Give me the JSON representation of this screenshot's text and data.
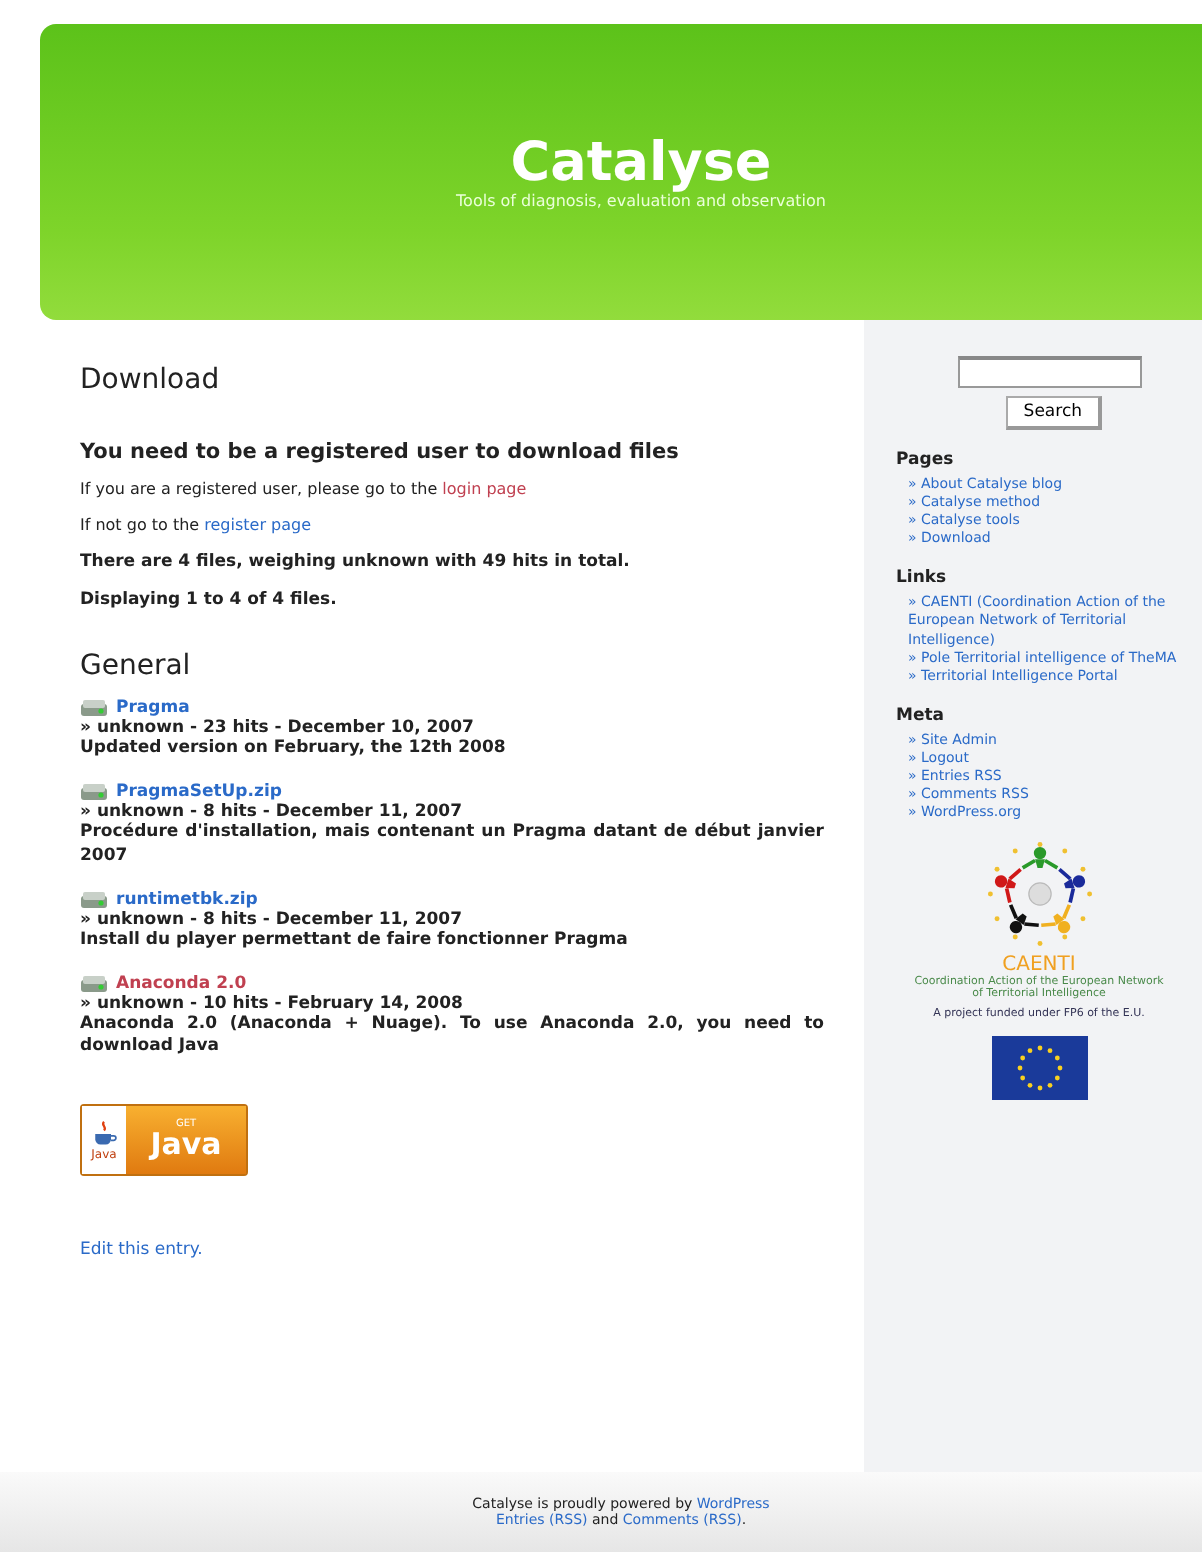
{
  "header": {
    "title": "Catalyse",
    "tagline": "Tools of diagnosis, evaluation and observation"
  },
  "main": {
    "heading": "Download",
    "notice": "You need to be a registered user to download files",
    "login_line": {
      "text": "If you are a registered user, please go to the",
      "link": "login page",
      "visited": true
    },
    "register_line": {
      "text": "If not go to the",
      "link": "register page",
      "visited": false
    },
    "summary": "There are 4 files, weighing unknown with 49 hits in total.",
    "displaying": "Displaying 1 to 4 of 4 files.",
    "section": "General",
    "files": [
      {
        "name": "Pragma",
        "visited": false,
        "meta": "» unknown - 23 hits - December 10, 2007",
        "description": "Updated version on February, the 12th 2008"
      },
      {
        "name": "PragmaSetUp.zip",
        "visited": false,
        "meta": "» unknown - 8 hits - December 11, 2007",
        "description": "Procédure d'installation, mais contenant un Pragma datant de début janvier 2007"
      },
      {
        "name": "runtimetbk.zip",
        "visited": false,
        "meta": "» unknown - 8 hits - December 11, 2007",
        "description": "Install du player permettant de faire fonctionner Pragma"
      },
      {
        "name": "Anaconda 2.0",
        "visited": true,
        "meta": "» unknown - 10 hits - February 14, 2008",
        "description": "Anaconda 2.0 (Anaconda + Nuage). To use Anaconda 2.0, you need to download Java"
      }
    ],
    "java_badge": {
      "small": "Java",
      "top": "GET",
      "big": "Java"
    },
    "edit_link": "Edit this entry."
  },
  "sidebar": {
    "search_button": "Search",
    "sections": [
      {
        "title": "Pages",
        "items": [
          "» About Catalyse blog",
          "» Catalyse method",
          "» Catalyse tools",
          "» Download"
        ]
      },
      {
        "title": "Links",
        "items": [
          "» CAENTI (Coordination Action of the European Network of Territorial Intelligence)",
          "» Pole Territorial intelligence of TheMA",
          "» Territorial Intelligence Portal"
        ]
      },
      {
        "title": "Meta",
        "items": [
          "» Site Admin",
          "» Logout",
          "» Entries RSS",
          "» Comments RSS",
          "» WordPress.org"
        ]
      }
    ],
    "caenti": {
      "name": "CAENTI",
      "caption": "Coordination Action of the European Network of Territorial Intelligence",
      "funding": "A project funded under FP6 of the E.U."
    }
  },
  "footer": {
    "line1": "Catalyse is proudly powered by",
    "link1": "WordPress",
    "link2": "Entries (RSS)",
    "and": "and",
    "link3": "Comments (RSS)",
    "end": "."
  }
}
